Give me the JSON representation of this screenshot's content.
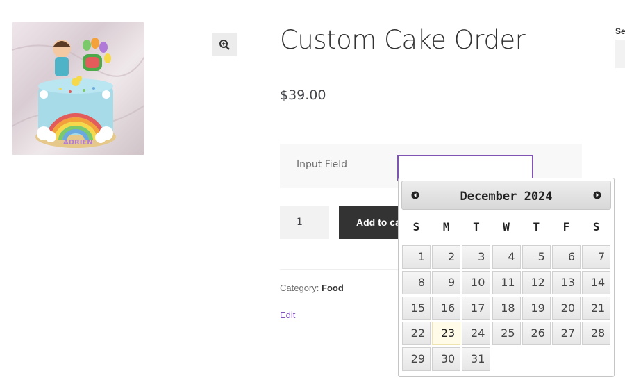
{
  "product": {
    "title": "Custom Cake Order",
    "price": "$39.00",
    "image": {
      "name_on_cake": "ADRIEN",
      "colors": {
        "cake": "#a8dbe8",
        "rainbow": [
          "#e35b5b",
          "#f3a13b",
          "#f6d94a",
          "#7cc96b",
          "#69a9e0",
          "#b07ad8"
        ]
      }
    }
  },
  "addon": {
    "label": "Input Field",
    "value": ""
  },
  "quantity": {
    "value": "1"
  },
  "add_to_cart": {
    "label": "Add to cart"
  },
  "meta": {
    "category_label": "Category:",
    "category_link": "Food",
    "edit_label": "Edit"
  },
  "sidebar": {
    "label": "Search"
  },
  "icons": {
    "zoom": "zoom-in-icon",
    "prev": "prev-month-icon",
    "next": "next-month-icon"
  },
  "colors": {
    "accent": "#7f54b3",
    "button_bg": "#333333",
    "today_bg": "#fffbe8"
  },
  "datepicker": {
    "month_label": "December 2024",
    "weekdays": [
      "S",
      "M",
      "T",
      "W",
      "T",
      "F",
      "S"
    ],
    "first_weekday_index": 0,
    "days_in_month": 31,
    "today": 23
  }
}
